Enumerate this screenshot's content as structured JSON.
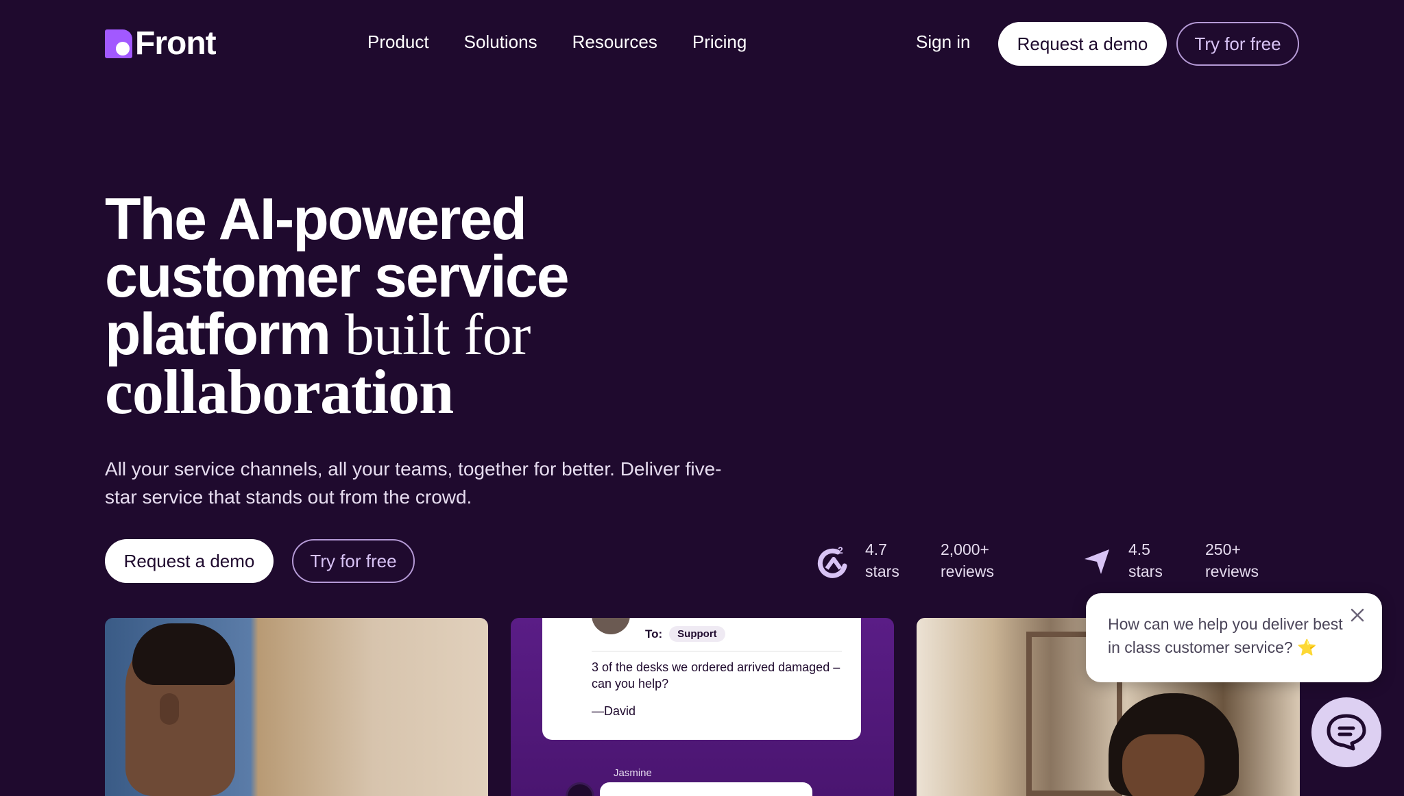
{
  "brand": {
    "name": "Front"
  },
  "nav": {
    "links": [
      "Product",
      "Solutions",
      "Resources",
      "Pricing"
    ],
    "sign_in": "Sign in",
    "request_demo": "Request a demo",
    "try_free": "Try for free"
  },
  "hero": {
    "line1": "The AI-powered",
    "line2": "customer service",
    "line3_sans": "platform ",
    "line3_serif": "built for",
    "line4": "collaboration",
    "subtitle": "All your service channels, all your teams, together for better. Deliver five-star service that stands out from the crowd.",
    "request_demo": "Request a demo",
    "try_free": "Try for free"
  },
  "ratings": [
    {
      "icon": "g2-icon",
      "score": "4.7",
      "score_label": "stars",
      "count": "2,000+",
      "count_label": "reviews"
    },
    {
      "icon": "capterra-icon",
      "score": "4.5",
      "score_label": "stars",
      "count": "250+",
      "count_label": "reviews"
    }
  ],
  "cards": {
    "message": {
      "to_label": "To:",
      "to_value": "Support",
      "body": "3 of the desks we ordered arrived damaged – can you help?",
      "signature": "—David",
      "reply_author": "Jasmine"
    }
  },
  "chat": {
    "prompt": "How can we help you deliver best in class customer service? ⭐"
  },
  "colors": {
    "background": "#1f0a2e",
    "brand_purple": "#a259ff",
    "outline_button": "#b59ad6",
    "chat_launcher": "#ddd0f2"
  }
}
